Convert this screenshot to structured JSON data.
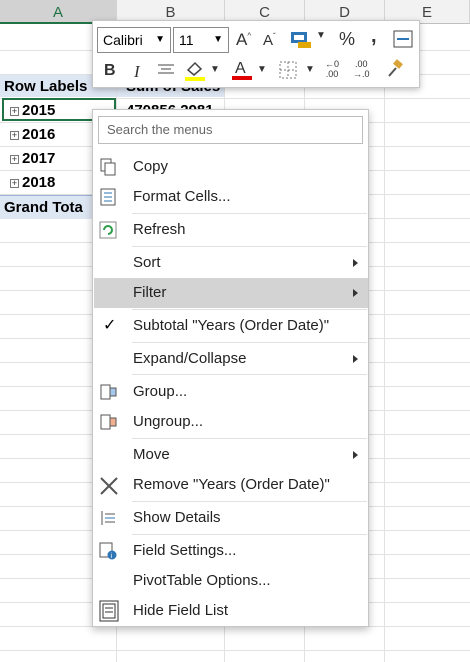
{
  "columns": [
    "A",
    "B",
    "C",
    "D",
    "E"
  ],
  "cells": {
    "row_labels": "Row Labels",
    "sum_header": "Sum of Sales",
    "years": [
      "2015",
      "2016",
      "2017",
      "2018"
    ],
    "first_value": "470856.2981",
    "grand_total": "Grand Tota"
  },
  "mini_toolbar": {
    "font_name": "Calibri",
    "font_size": "11",
    "percent": "%",
    "comma": ","
  },
  "menu": {
    "search_placeholder": "Search the menus",
    "items": [
      {
        "label": "Copy"
      },
      {
        "label": "Format Cells..."
      },
      {
        "label": "Refresh"
      },
      {
        "label": "Sort"
      },
      {
        "label": "Filter"
      },
      {
        "label": "Subtotal \"Years (Order Date)\""
      },
      {
        "label": "Expand/Collapse"
      },
      {
        "label": "Group..."
      },
      {
        "label": "Ungroup..."
      },
      {
        "label": "Move"
      },
      {
        "label": "Remove \"Years (Order Date)\""
      },
      {
        "label": "Show Details"
      },
      {
        "label": "Field Settings..."
      },
      {
        "label": "PivotTable Options..."
      },
      {
        "label": "Hide Field List"
      }
    ]
  },
  "colors": {
    "accent": "#217346",
    "pivot_header": "#dde6f3",
    "highlight": "#d3d3d3"
  }
}
